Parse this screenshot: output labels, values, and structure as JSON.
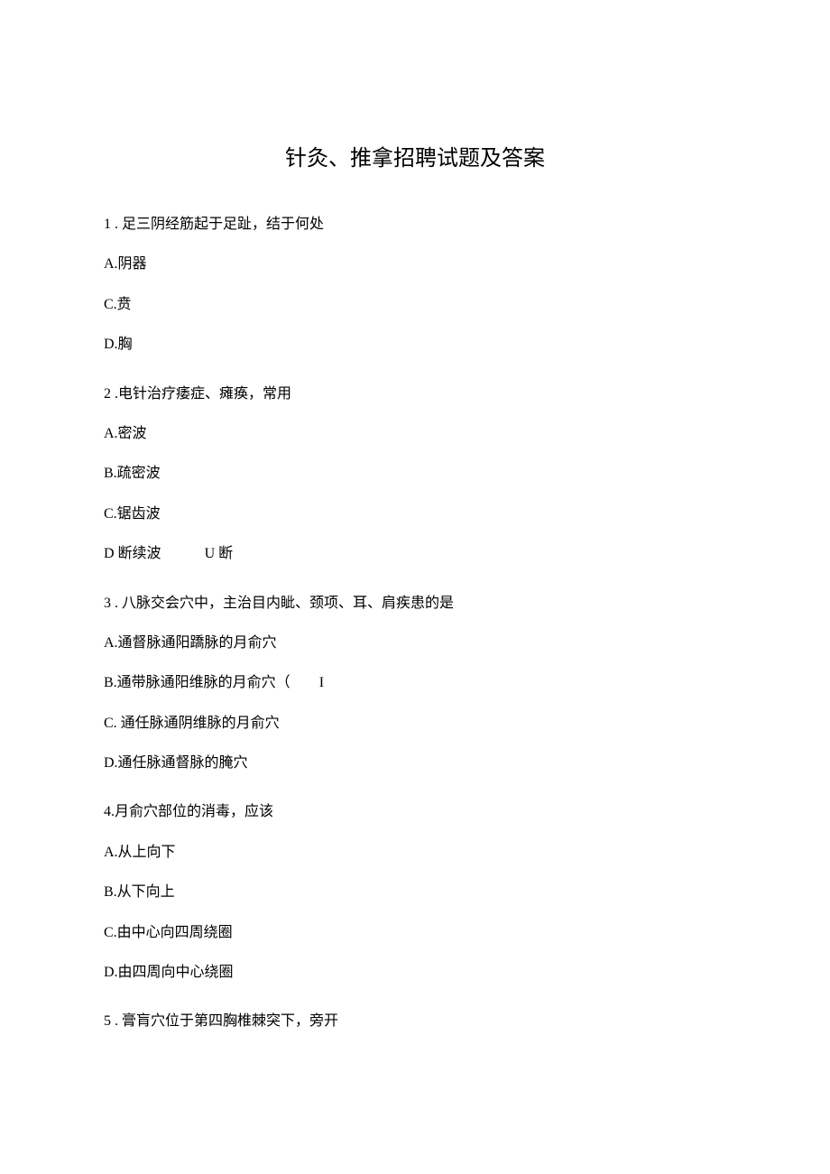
{
  "title": "针灸、推拿招聘试题及答案",
  "q1": {
    "stem": "1 . 足三阴经筋起于足趾，结于何处",
    "a": "A.阴器",
    "c": "C.贲",
    "d": "D.胸"
  },
  "q2": {
    "stem": "2  .电针治疗痿症、瘫痪，常用",
    "a": "A.密波",
    "b": "B.疏密波",
    "c": "C.锯齿波",
    "d_left": "D 断续波",
    "d_right": "U 断"
  },
  "q3": {
    "stem": "3  . 八脉交会穴中，主治目内眦、颈项、耳、肩疾患的是",
    "a": "A.通督脉通阳蹻脉的月俞穴",
    "b_left": "B.通带脉通阳维脉的月俞穴（",
    "b_right": "I",
    "c": "C. 通任脉通阴维脉的月俞穴",
    "d": "D.通任脉通督脉的腌穴"
  },
  "q4": {
    "stem": "4.月俞穴部位的消毒，应该",
    "a": "A.从上向下",
    "b": "B.从下向上",
    "c": "C.由中心向四周绕圈",
    "d": "D.由四周向中心绕圈"
  },
  "q5": {
    "stem": "5  . 膏肓穴位于第四胸椎棘突下，旁开"
  }
}
